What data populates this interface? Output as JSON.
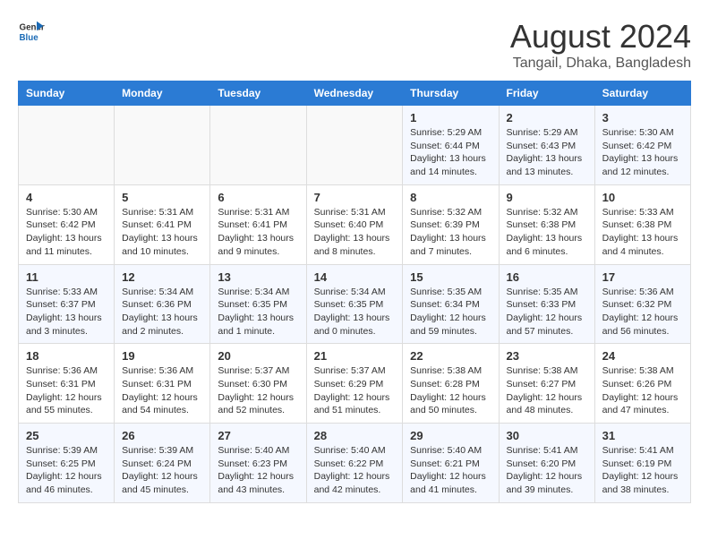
{
  "header": {
    "logo_line1": "General",
    "logo_line2": "Blue",
    "title": "August 2024",
    "subtitle": "Tangail, Dhaka, Bangladesh"
  },
  "weekdays": [
    "Sunday",
    "Monday",
    "Tuesday",
    "Wednesday",
    "Thursday",
    "Friday",
    "Saturday"
  ],
  "weeks": [
    [
      {
        "day": "",
        "info": ""
      },
      {
        "day": "",
        "info": ""
      },
      {
        "day": "",
        "info": ""
      },
      {
        "day": "",
        "info": ""
      },
      {
        "day": "1",
        "info": "Sunrise: 5:29 AM\nSunset: 6:44 PM\nDaylight: 13 hours\nand 14 minutes."
      },
      {
        "day": "2",
        "info": "Sunrise: 5:29 AM\nSunset: 6:43 PM\nDaylight: 13 hours\nand 13 minutes."
      },
      {
        "day": "3",
        "info": "Sunrise: 5:30 AM\nSunset: 6:42 PM\nDaylight: 13 hours\nand 12 minutes."
      }
    ],
    [
      {
        "day": "4",
        "info": "Sunrise: 5:30 AM\nSunset: 6:42 PM\nDaylight: 13 hours\nand 11 minutes."
      },
      {
        "day": "5",
        "info": "Sunrise: 5:31 AM\nSunset: 6:41 PM\nDaylight: 13 hours\nand 10 minutes."
      },
      {
        "day": "6",
        "info": "Sunrise: 5:31 AM\nSunset: 6:41 PM\nDaylight: 13 hours\nand 9 minutes."
      },
      {
        "day": "7",
        "info": "Sunrise: 5:31 AM\nSunset: 6:40 PM\nDaylight: 13 hours\nand 8 minutes."
      },
      {
        "day": "8",
        "info": "Sunrise: 5:32 AM\nSunset: 6:39 PM\nDaylight: 13 hours\nand 7 minutes."
      },
      {
        "day": "9",
        "info": "Sunrise: 5:32 AM\nSunset: 6:38 PM\nDaylight: 13 hours\nand 6 minutes."
      },
      {
        "day": "10",
        "info": "Sunrise: 5:33 AM\nSunset: 6:38 PM\nDaylight: 13 hours\nand 4 minutes."
      }
    ],
    [
      {
        "day": "11",
        "info": "Sunrise: 5:33 AM\nSunset: 6:37 PM\nDaylight: 13 hours\nand 3 minutes."
      },
      {
        "day": "12",
        "info": "Sunrise: 5:34 AM\nSunset: 6:36 PM\nDaylight: 13 hours\nand 2 minutes."
      },
      {
        "day": "13",
        "info": "Sunrise: 5:34 AM\nSunset: 6:35 PM\nDaylight: 13 hours\nand 1 minute."
      },
      {
        "day": "14",
        "info": "Sunrise: 5:34 AM\nSunset: 6:35 PM\nDaylight: 13 hours\nand 0 minutes."
      },
      {
        "day": "15",
        "info": "Sunrise: 5:35 AM\nSunset: 6:34 PM\nDaylight: 12 hours\nand 59 minutes."
      },
      {
        "day": "16",
        "info": "Sunrise: 5:35 AM\nSunset: 6:33 PM\nDaylight: 12 hours\nand 57 minutes."
      },
      {
        "day": "17",
        "info": "Sunrise: 5:36 AM\nSunset: 6:32 PM\nDaylight: 12 hours\nand 56 minutes."
      }
    ],
    [
      {
        "day": "18",
        "info": "Sunrise: 5:36 AM\nSunset: 6:31 PM\nDaylight: 12 hours\nand 55 minutes."
      },
      {
        "day": "19",
        "info": "Sunrise: 5:36 AM\nSunset: 6:31 PM\nDaylight: 12 hours\nand 54 minutes."
      },
      {
        "day": "20",
        "info": "Sunrise: 5:37 AM\nSunset: 6:30 PM\nDaylight: 12 hours\nand 52 minutes."
      },
      {
        "day": "21",
        "info": "Sunrise: 5:37 AM\nSunset: 6:29 PM\nDaylight: 12 hours\nand 51 minutes."
      },
      {
        "day": "22",
        "info": "Sunrise: 5:38 AM\nSunset: 6:28 PM\nDaylight: 12 hours\nand 50 minutes."
      },
      {
        "day": "23",
        "info": "Sunrise: 5:38 AM\nSunset: 6:27 PM\nDaylight: 12 hours\nand 48 minutes."
      },
      {
        "day": "24",
        "info": "Sunrise: 5:38 AM\nSunset: 6:26 PM\nDaylight: 12 hours\nand 47 minutes."
      }
    ],
    [
      {
        "day": "25",
        "info": "Sunrise: 5:39 AM\nSunset: 6:25 PM\nDaylight: 12 hours\nand 46 minutes."
      },
      {
        "day": "26",
        "info": "Sunrise: 5:39 AM\nSunset: 6:24 PM\nDaylight: 12 hours\nand 45 minutes."
      },
      {
        "day": "27",
        "info": "Sunrise: 5:40 AM\nSunset: 6:23 PM\nDaylight: 12 hours\nand 43 minutes."
      },
      {
        "day": "28",
        "info": "Sunrise: 5:40 AM\nSunset: 6:22 PM\nDaylight: 12 hours\nand 42 minutes."
      },
      {
        "day": "29",
        "info": "Sunrise: 5:40 AM\nSunset: 6:21 PM\nDaylight: 12 hours\nand 41 minutes."
      },
      {
        "day": "30",
        "info": "Sunrise: 5:41 AM\nSunset: 6:20 PM\nDaylight: 12 hours\nand 39 minutes."
      },
      {
        "day": "31",
        "info": "Sunrise: 5:41 AM\nSunset: 6:19 PM\nDaylight: 12 hours\nand 38 minutes."
      }
    ]
  ]
}
